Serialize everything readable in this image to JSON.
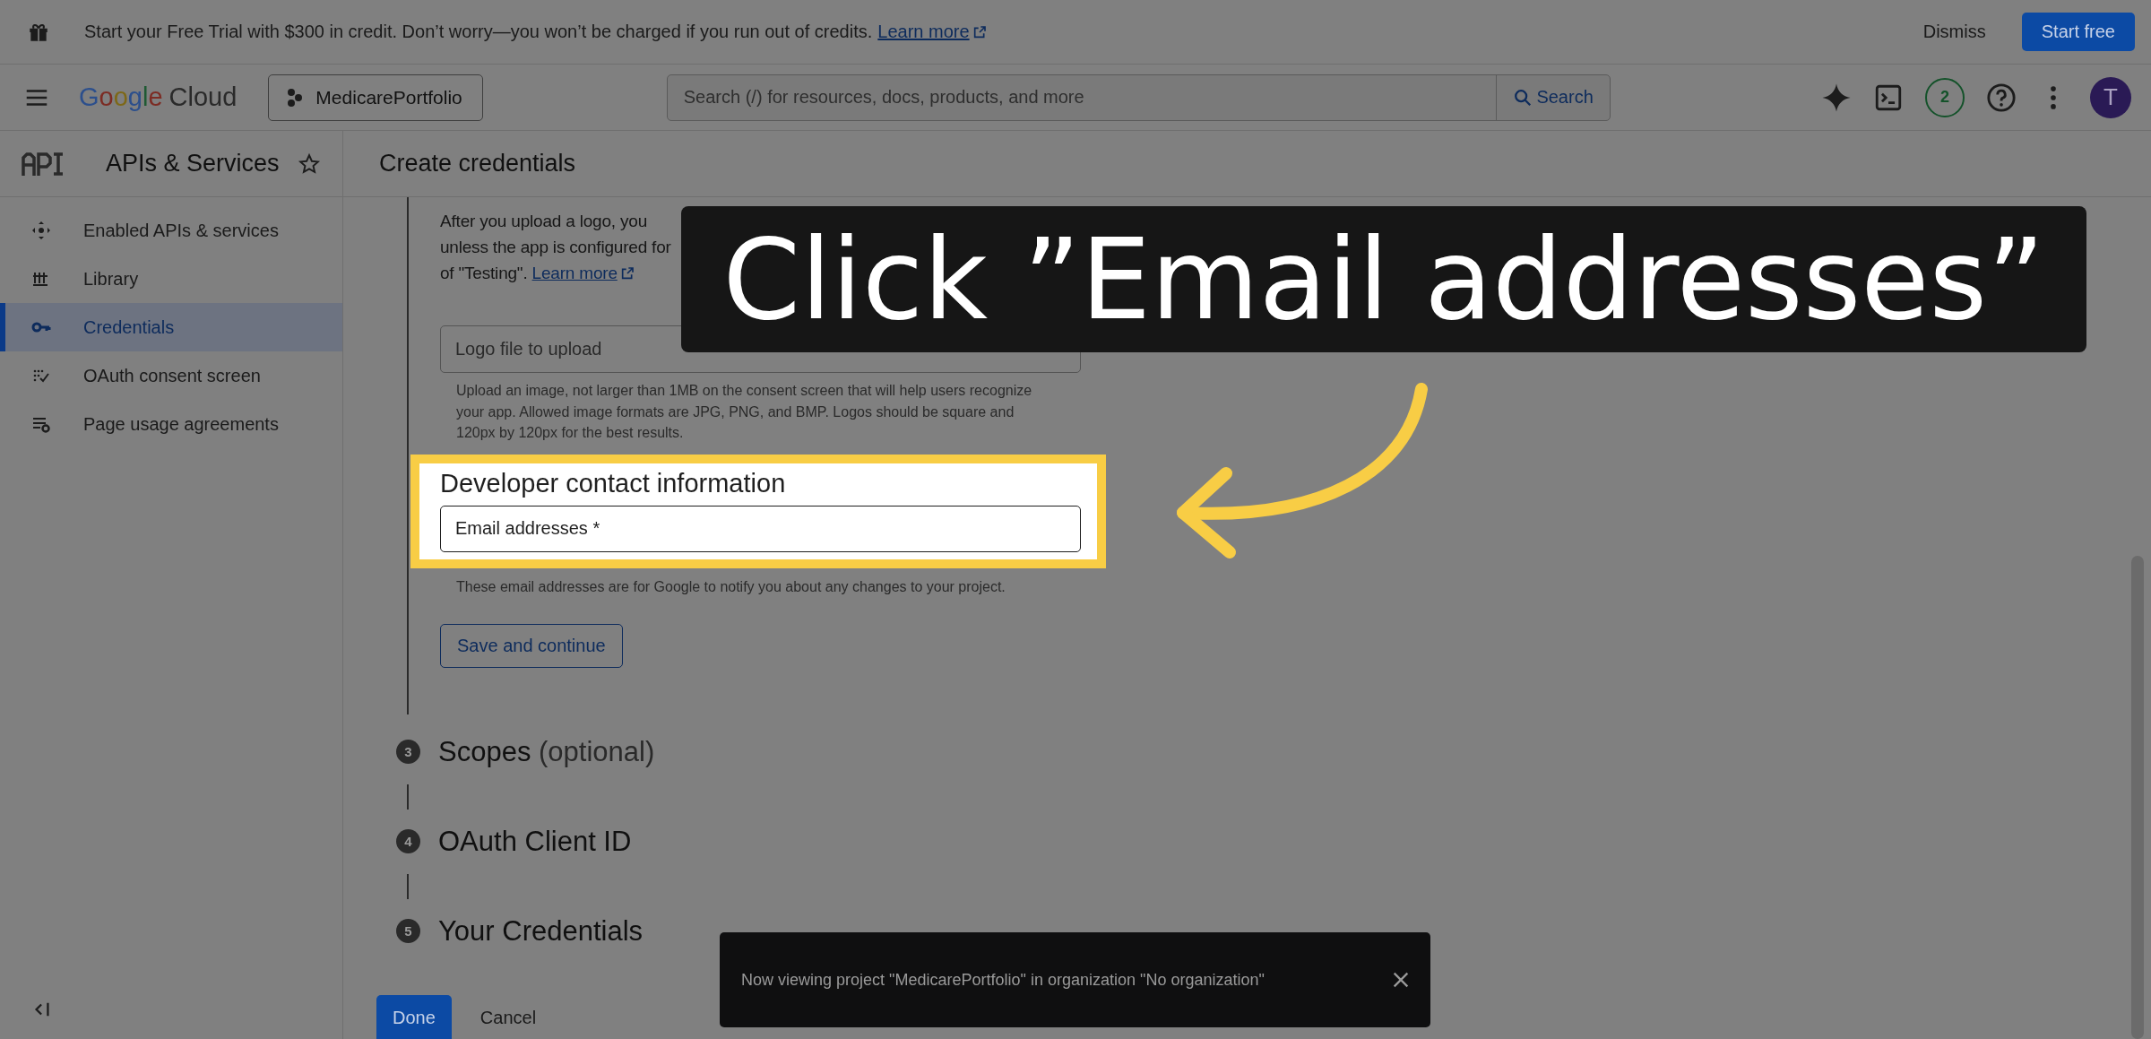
{
  "banner": {
    "text": "Start your Free Trial with $300 in credit. Don’t worry—you won’t be charged if you run out of credits.",
    "link": "Learn more",
    "dismiss": "Dismiss",
    "action": "Start free"
  },
  "header": {
    "logo": {
      "brand": "Google",
      "product": "Cloud"
    },
    "project": "MedicarePortfolio",
    "search": {
      "placeholder": "Search (/) for resources, docs, products, and more",
      "button": "Search"
    },
    "notifications": "2",
    "avatar": "T"
  },
  "sidebar": {
    "title": "APIs & Services",
    "items": [
      {
        "label": "Enabled APIs & services",
        "selected": false
      },
      {
        "label": "Library",
        "selected": false
      },
      {
        "label": "Credentials",
        "selected": true
      },
      {
        "label": "OAuth consent screen",
        "selected": false
      },
      {
        "label": "Page usage agreements",
        "selected": false
      }
    ]
  },
  "page": {
    "title": "Create credentials",
    "intro_lines": [
      "After you upload a logo, you",
      "unless the app is configured for",
      "of \"Testing\"."
    ],
    "intro_link": "Learn more",
    "logo_field": {
      "placeholder": "Logo file to upload"
    },
    "logo_help": "Upload an image, not larger than 1MB on the consent screen that will help users recognize your app. Allowed image formats are JPG, PNG, and BMP. Logos should be square and 120px by 120px for the best results.",
    "contact": {
      "heading": "Developer contact information",
      "email": {
        "placeholder": "Email addresses *"
      },
      "help": "These email addresses are for Google to notify you about any changes to your project."
    },
    "save": "Save and continue",
    "steps": [
      {
        "number": "3",
        "title": "Scopes",
        "note": "(optional)"
      },
      {
        "number": "4",
        "title": "OAuth Client ID"
      },
      {
        "number": "5",
        "title": "Your Credentials"
      }
    ],
    "done": "Done",
    "cancel": "Cancel"
  },
  "snackbar": {
    "text": "Now viewing project \"MedicarePortfolio\" in organization \"No organization\""
  },
  "tutorial": {
    "callout": "Click ”Email addresses”"
  }
}
